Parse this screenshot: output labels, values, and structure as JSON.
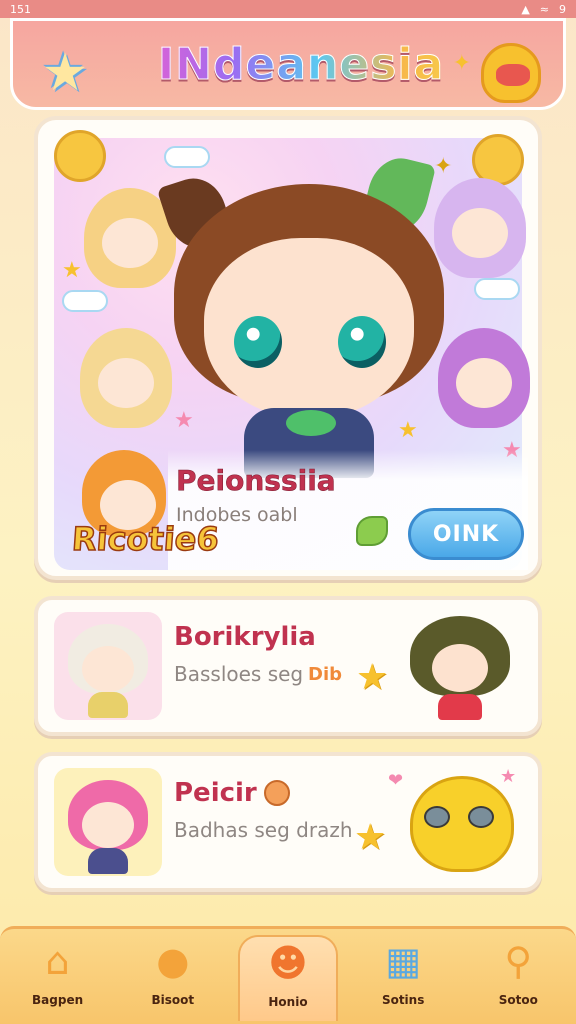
{
  "status": {
    "time": "151",
    "right": "9"
  },
  "header": {
    "title": "INdeanesia"
  },
  "featured": {
    "name": "Peionssiia",
    "subtitle": "Indobes oabl",
    "button_label": "OINK",
    "logo_text": "Ricotie6"
  },
  "cards": [
    {
      "title": "Borikrylia",
      "subtitle": "Bassloes seg",
      "tag": "Dib"
    },
    {
      "title": "Peicir",
      "subtitle": "Badhas seg drazh"
    }
  ],
  "nav": [
    {
      "label": "Bagpen",
      "icon": "home-icon"
    },
    {
      "label": "Bisoot",
      "icon": "bear-icon"
    },
    {
      "label": "Honio",
      "icon": "face-icon"
    },
    {
      "label": "Sotins",
      "icon": "chart-icon"
    },
    {
      "label": "Sotoo",
      "icon": "search-icon"
    }
  ],
  "colors": {
    "header": "#f6a6a0",
    "accent_text": "#c0324f",
    "button": "#4aa8e8",
    "navbar": "#f8c56b"
  }
}
